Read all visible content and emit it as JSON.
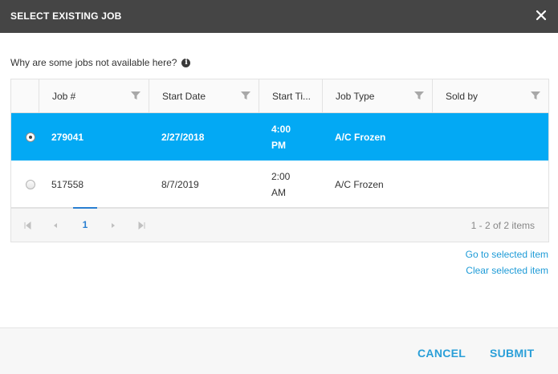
{
  "dialog": {
    "title": "SELECT EXISTING JOB"
  },
  "info": {
    "text": "Why are some jobs not available here?",
    "icon": "info-icon"
  },
  "grid": {
    "columns": [
      "Job #",
      "Start Date",
      "Start Ti...",
      "Job Type",
      "Sold by"
    ],
    "rows": [
      {
        "selected": true,
        "job": "279041",
        "date": "2/27/2018",
        "time1": "4:00",
        "time2": "PM",
        "type": "A/C Frozen",
        "sold_by": ""
      },
      {
        "selected": false,
        "job": "517558",
        "date": "8/7/2019",
        "time1": "2:00",
        "time2": "AM",
        "type": "A/C Frozen",
        "sold_by": ""
      }
    ]
  },
  "pager": {
    "current_page": "1",
    "info": "1 - 2 of 2 items"
  },
  "links": {
    "goto": "Go to selected item",
    "clear": "Clear selected item"
  },
  "footer": {
    "cancel": "CANCEL",
    "submit": "SUBMIT"
  },
  "colors": {
    "titlebar": "#454545",
    "selected_row": "#03a9f4",
    "accent": "#2a9fd8"
  }
}
